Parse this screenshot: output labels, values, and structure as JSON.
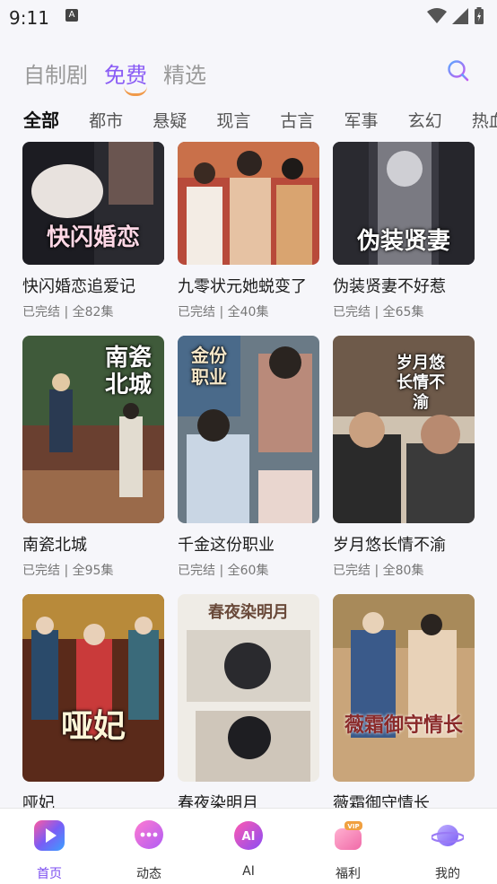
{
  "status_bar": {
    "time": "9:11",
    "app_indicator": "A"
  },
  "top_tabs": [
    {
      "label": "自制剧"
    },
    {
      "label": "免费"
    },
    {
      "label": "精选"
    }
  ],
  "categories": [
    "全部",
    "都市",
    "悬疑",
    "现言",
    "古言",
    "军事",
    "玄幻",
    "热血"
  ],
  "dramas": [
    {
      "title": "快闪婚恋追爱记",
      "status": "已完结",
      "episodes": "全82集",
      "poster_text": "快闪婚恋",
      "colors": [
        "#1c1c22",
        "#6a5550",
        "#e8e2de"
      ]
    },
    {
      "title": "九零状元她蜕变了",
      "status": "已完结",
      "episodes": "全40集",
      "poster_text": "",
      "colors": [
        "#b84a3a",
        "#e6c2a3",
        "#f3ece4"
      ]
    },
    {
      "title": "伪装贤妻不好惹",
      "status": "已完结",
      "episodes": "全65集",
      "poster_text": "伪装贤妻",
      "colors": [
        "#3a3a42",
        "#7a7a82",
        "#cfcfd4"
      ]
    },
    {
      "title": "南瓷北城",
      "status": "已完结",
      "episodes": "全95集",
      "poster_text": "南瓷北城",
      "colors": [
        "#3f5a3a",
        "#9a6a4a",
        "#e2c9a4"
      ]
    },
    {
      "title": "千金这份职业",
      "status": "已完结",
      "episodes": "全60集",
      "poster_text": "金份职业",
      "colors": [
        "#6a7a86",
        "#b98a7a",
        "#e9d6cf"
      ]
    },
    {
      "title": "岁月悠长情不渝",
      "status": "已完结",
      "episodes": "全80集",
      "poster_text": "岁月悠长情不渝",
      "colors": [
        "#2a2a2a",
        "#6e5a4a",
        "#cfc2b0"
      ]
    },
    {
      "title": "哑妃",
      "status": "",
      "episodes": "",
      "poster_text": "哑妃",
      "colors": [
        "#5a2a1a",
        "#b88a3a",
        "#2a4a6a"
      ]
    },
    {
      "title": "春夜染明月",
      "status": "",
      "episodes": "",
      "poster_text": "春夜染明月",
      "colors": [
        "#efece6",
        "#2a2a2e",
        "#d8d2c8"
      ]
    },
    {
      "title": "薇霜御守情长",
      "status": "",
      "episodes": "",
      "poster_text": "薇霜御守情长",
      "colors": [
        "#c9a57a",
        "#e8d2b8",
        "#3a5a8a"
      ]
    }
  ],
  "bottom_nav": [
    {
      "label": "首页",
      "icon": "play-icon",
      "color": "#6a4cf5"
    },
    {
      "label": "动态",
      "icon": "chat-bubble-icon",
      "color": "#d56cf2"
    },
    {
      "label": "AI",
      "icon": "ai-icon",
      "color": "#d94ae0"
    },
    {
      "label": "福利",
      "icon": "vip-gift-icon",
      "color": "#f07ab4"
    },
    {
      "label": "我的",
      "icon": "planet-icon",
      "color": "#9b7bf5"
    }
  ],
  "accent_color": "#8a5cf5"
}
